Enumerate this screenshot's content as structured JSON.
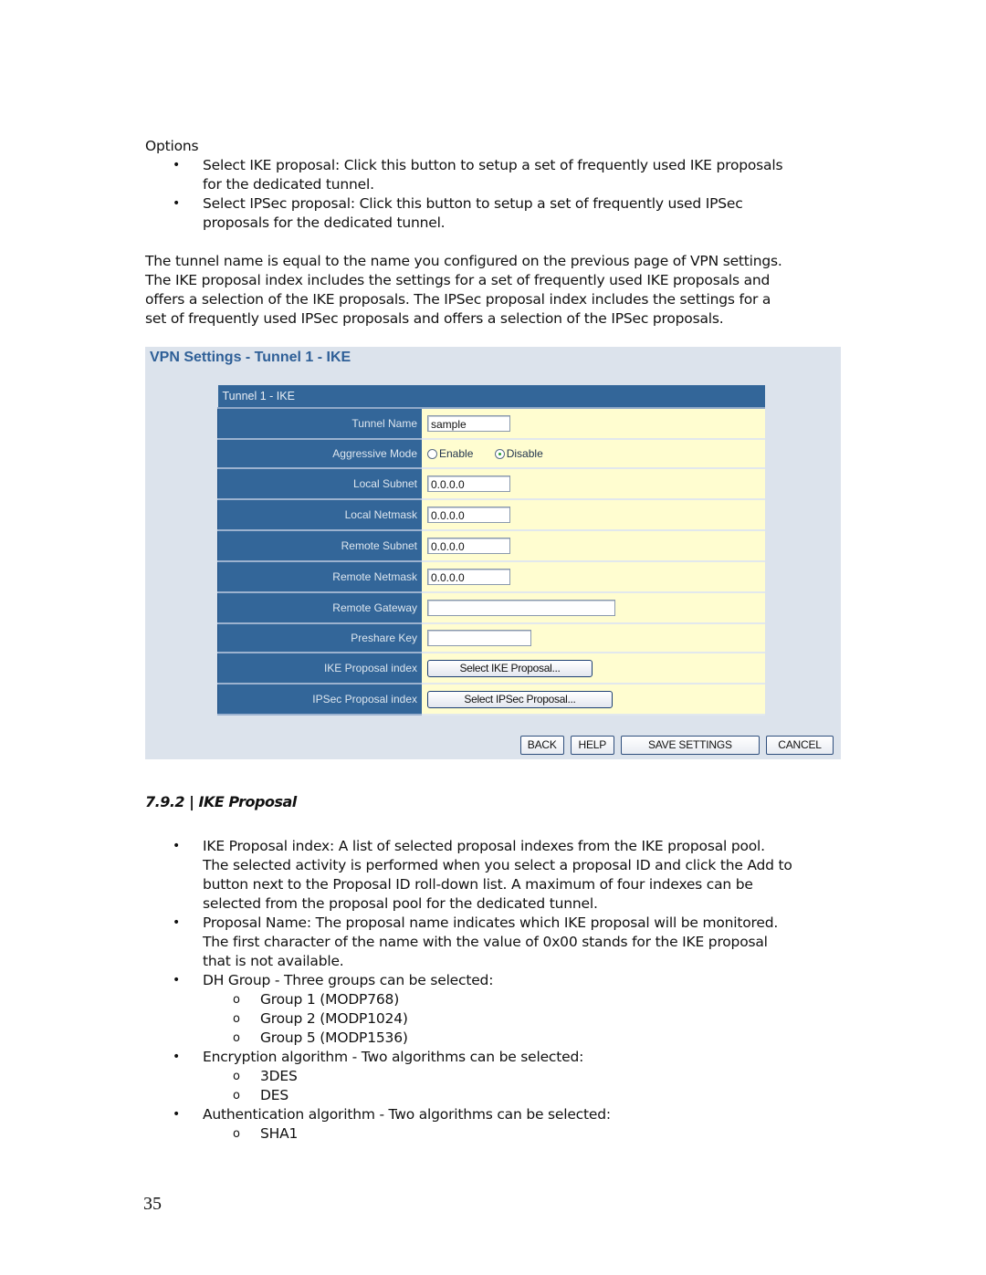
{
  "options": {
    "title": "Options",
    "items": [
      {
        "text": "Select IKE proposal: Click this button to setup a set of frequently used IKE proposals",
        "text2": "for the dedicated tunnel."
      },
      {
        "text": "Select IPSec proposal: Click this button to setup a set of frequently used IPSec",
        "text2": "proposals for the dedicated tunnel."
      }
    ]
  },
  "intro": {
    "lines": [
      "The tunnel name is equal to the name you configured on the previous page of VPN settings.",
      "The IKE proposal index includes the settings for a set of frequently used IKE proposals and",
      "offers a selection of the IKE proposals. The IPSec proposal index includes the settings for a",
      "set of frequently used IPSec proposals and offers a selection of the IPSec proposals."
    ]
  },
  "vpn_panel": {
    "title": "VPN Settings - Tunnel 1 - IKE",
    "table_header": "Tunnel 1 - IKE",
    "fields": {
      "tunnel_name": {
        "label": "Tunnel Name",
        "value": "sample"
      },
      "aggressive_mode": {
        "label": "Aggressive Mode",
        "options": [
          "Enable",
          "Disable"
        ],
        "selected": "Disable"
      },
      "local_subnet": {
        "label": "Local Subnet",
        "value": "0.0.0.0"
      },
      "local_netmask": {
        "label": "Local Netmask",
        "value": "0.0.0.0"
      },
      "remote_subnet": {
        "label": "Remote Subnet",
        "value": "0.0.0.0"
      },
      "remote_netmask": {
        "label": "Remote Netmask",
        "value": "0.0.0.0"
      },
      "remote_gateway": {
        "label": "Remote Gateway",
        "value": ""
      },
      "preshare_key": {
        "label": "Preshare Key",
        "value": ""
      },
      "ike_proposal_index": {
        "label": "IKE Proposal index",
        "button": "Select IKE Proposal..."
      },
      "ipsec_proposal_index": {
        "label": "IPSec Proposal index",
        "button": "Select IPSec Proposal..."
      }
    },
    "buttons": {
      "back": "BACK",
      "help": "HELP",
      "save": "SAVE SETTINGS",
      "cancel": "CANCEL"
    }
  },
  "section": {
    "heading": "7.9.2 | IKE Proposal",
    "items": [
      {
        "lines": [
          "IKE Proposal index: A list of selected proposal indexes from the IKE proposal pool.",
          "The selected activity is performed when you select a proposal ID and click the Add to",
          "button next to the Proposal ID roll-down list. A maximum of four indexes can be",
          "selected from the proposal pool for the dedicated tunnel."
        ]
      },
      {
        "lines": [
          "Proposal Name: The proposal name indicates which IKE proposal will be monitored.",
          "The first character of the name with the value of 0x00 stands for the IKE proposal",
          "that is not available."
        ]
      },
      {
        "lines": [
          "DH Group - Three groups can be selected:"
        ],
        "sub": [
          "Group 1 (MODP768)",
          "Group 2 (MODP1024)",
          "Group 5 (MODP1536)"
        ]
      },
      {
        "lines": [
          "Encryption algorithm - Two algorithms can be selected:"
        ],
        "sub": [
          "3DES",
          "DES"
        ]
      },
      {
        "lines": [
          "Authentication algorithm - Two algorithms can be selected:"
        ],
        "sub": [
          "SHA1"
        ]
      }
    ]
  },
  "page_number": "35",
  "colors": {
    "header_blue": "#336699",
    "value_yellow": "#fffdd0",
    "panel_bg": "#dce3ec",
    "title_blue": "#2e5f97"
  }
}
